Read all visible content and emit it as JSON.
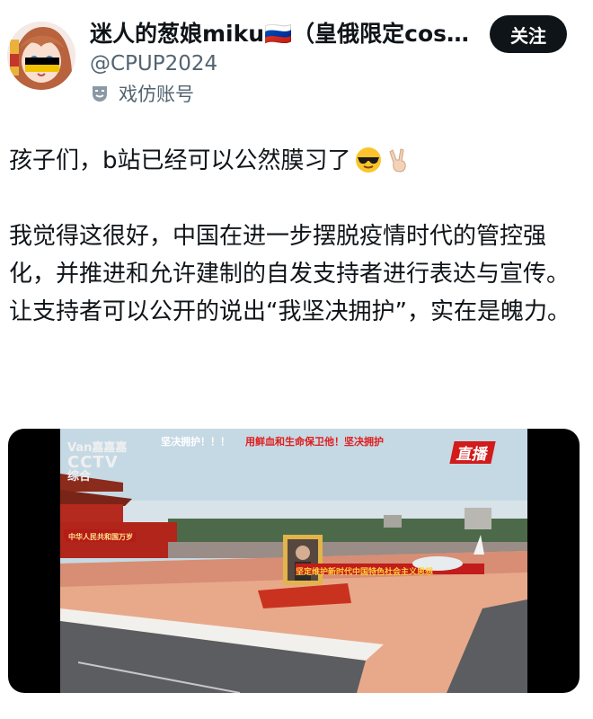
{
  "user": {
    "display_name": "迷人的葱娘miku🇷🇺（皇俄限定cosp...",
    "handle": "@CPUP2024",
    "badge_icon": "theater-mask-icon",
    "badge_label": "戏仿账号"
  },
  "follow_button": {
    "label": "关注"
  },
  "tweet": {
    "line1": "孩子们，b站已经可以公然膜习了",
    "emoji": [
      "sunglasses-emoji",
      "victory-hand-emoji"
    ],
    "para2": "我觉得这很好，中国在进一步摆脱疫情时代的管控强化，并推进和允许建制的自发支持者进行表达与宣传。",
    "para3": "让支持者可以公开的说出“我坚决拥护”，实在是魄力。"
  },
  "video": {
    "watermark_top": "Van嘉嘉嘉",
    "watermark_cctv": "CCTV",
    "watermark_bottom": "综合",
    "danmu_1": "坚决拥护！！！",
    "danmu_2": "用鲜血和生命保卫他！坚决拥护",
    "live_label": "直播",
    "banner_text": "坚定维护新时代中国特色社会主义思想",
    "gate_sign": "中华人民共和国万岁",
    "colors": {
      "sky": "#c5d9e4",
      "crowd": "#e8a98b",
      "gate": "#b1251b"
    }
  },
  "colors": {
    "text": "#0f1419",
    "secondary": "#536471",
    "button_bg": "#0f1419"
  }
}
